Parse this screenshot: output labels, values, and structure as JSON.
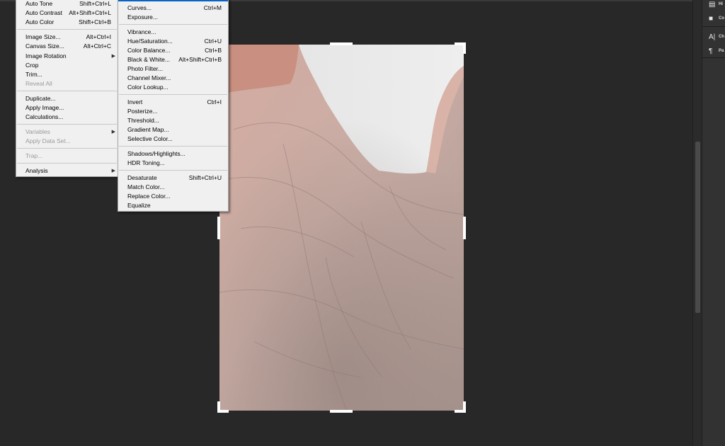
{
  "image_menu": {
    "items": [
      {
        "label": "Auto Tone",
        "shortcut": "Shift+Ctrl+L"
      },
      {
        "label": "Auto Contrast",
        "shortcut": "Alt+Shift+Ctrl+L"
      },
      {
        "label": "Auto Color",
        "shortcut": "Shift+Ctrl+B"
      },
      {
        "label": "Image Size...",
        "shortcut": "Alt+Ctrl+I"
      },
      {
        "label": "Canvas Size...",
        "shortcut": "Alt+Ctrl+C"
      },
      {
        "label": "Image Rotation"
      },
      {
        "label": "Crop"
      },
      {
        "label": "Trim..."
      },
      {
        "label": "Reveal All"
      },
      {
        "label": "Duplicate..."
      },
      {
        "label": "Apply Image..."
      },
      {
        "label": "Calculations..."
      },
      {
        "label": "Variables"
      },
      {
        "label": "Apply Data Set..."
      },
      {
        "label": "Trap..."
      },
      {
        "label": "Analysis"
      }
    ]
  },
  "adjustments_menu": {
    "items": [
      {
        "label": "Curves...",
        "shortcut": "Ctrl+M"
      },
      {
        "label": "Exposure..."
      },
      {
        "label": "Vibrance..."
      },
      {
        "label": "Hue/Saturation...",
        "shortcut": "Ctrl+U"
      },
      {
        "label": "Color Balance...",
        "shortcut": "Ctrl+B"
      },
      {
        "label": "Black & White...",
        "shortcut": "Alt+Shift+Ctrl+B"
      },
      {
        "label": "Photo Filter..."
      },
      {
        "label": "Channel Mixer..."
      },
      {
        "label": "Color Lookup..."
      },
      {
        "label": "Invert",
        "shortcut": "Ctrl+I"
      },
      {
        "label": "Posterize..."
      },
      {
        "label": "Threshold..."
      },
      {
        "label": "Gradient Map..."
      },
      {
        "label": "Selective Color..."
      },
      {
        "label": "Shadows/Highlights..."
      },
      {
        "label": "HDR Toning..."
      },
      {
        "label": "Desaturate",
        "shortcut": "Shift+Ctrl+U"
      },
      {
        "label": "Match Color..."
      },
      {
        "label": "Replace Color..."
      },
      {
        "label": "Equalize"
      }
    ]
  },
  "right_panel": {
    "items": [
      {
        "icon": "history-icon",
        "label": "Hi"
      },
      {
        "icon": "comments-icon",
        "label": "Co"
      },
      {
        "icon": "character-icon",
        "label": "Ch"
      },
      {
        "icon": "paragraph-icon",
        "label": "Pa"
      }
    ]
  },
  "colors": {
    "workspace": "#282828",
    "menu_bg": "#f0f0f0",
    "highlight": "#0a64c8"
  }
}
